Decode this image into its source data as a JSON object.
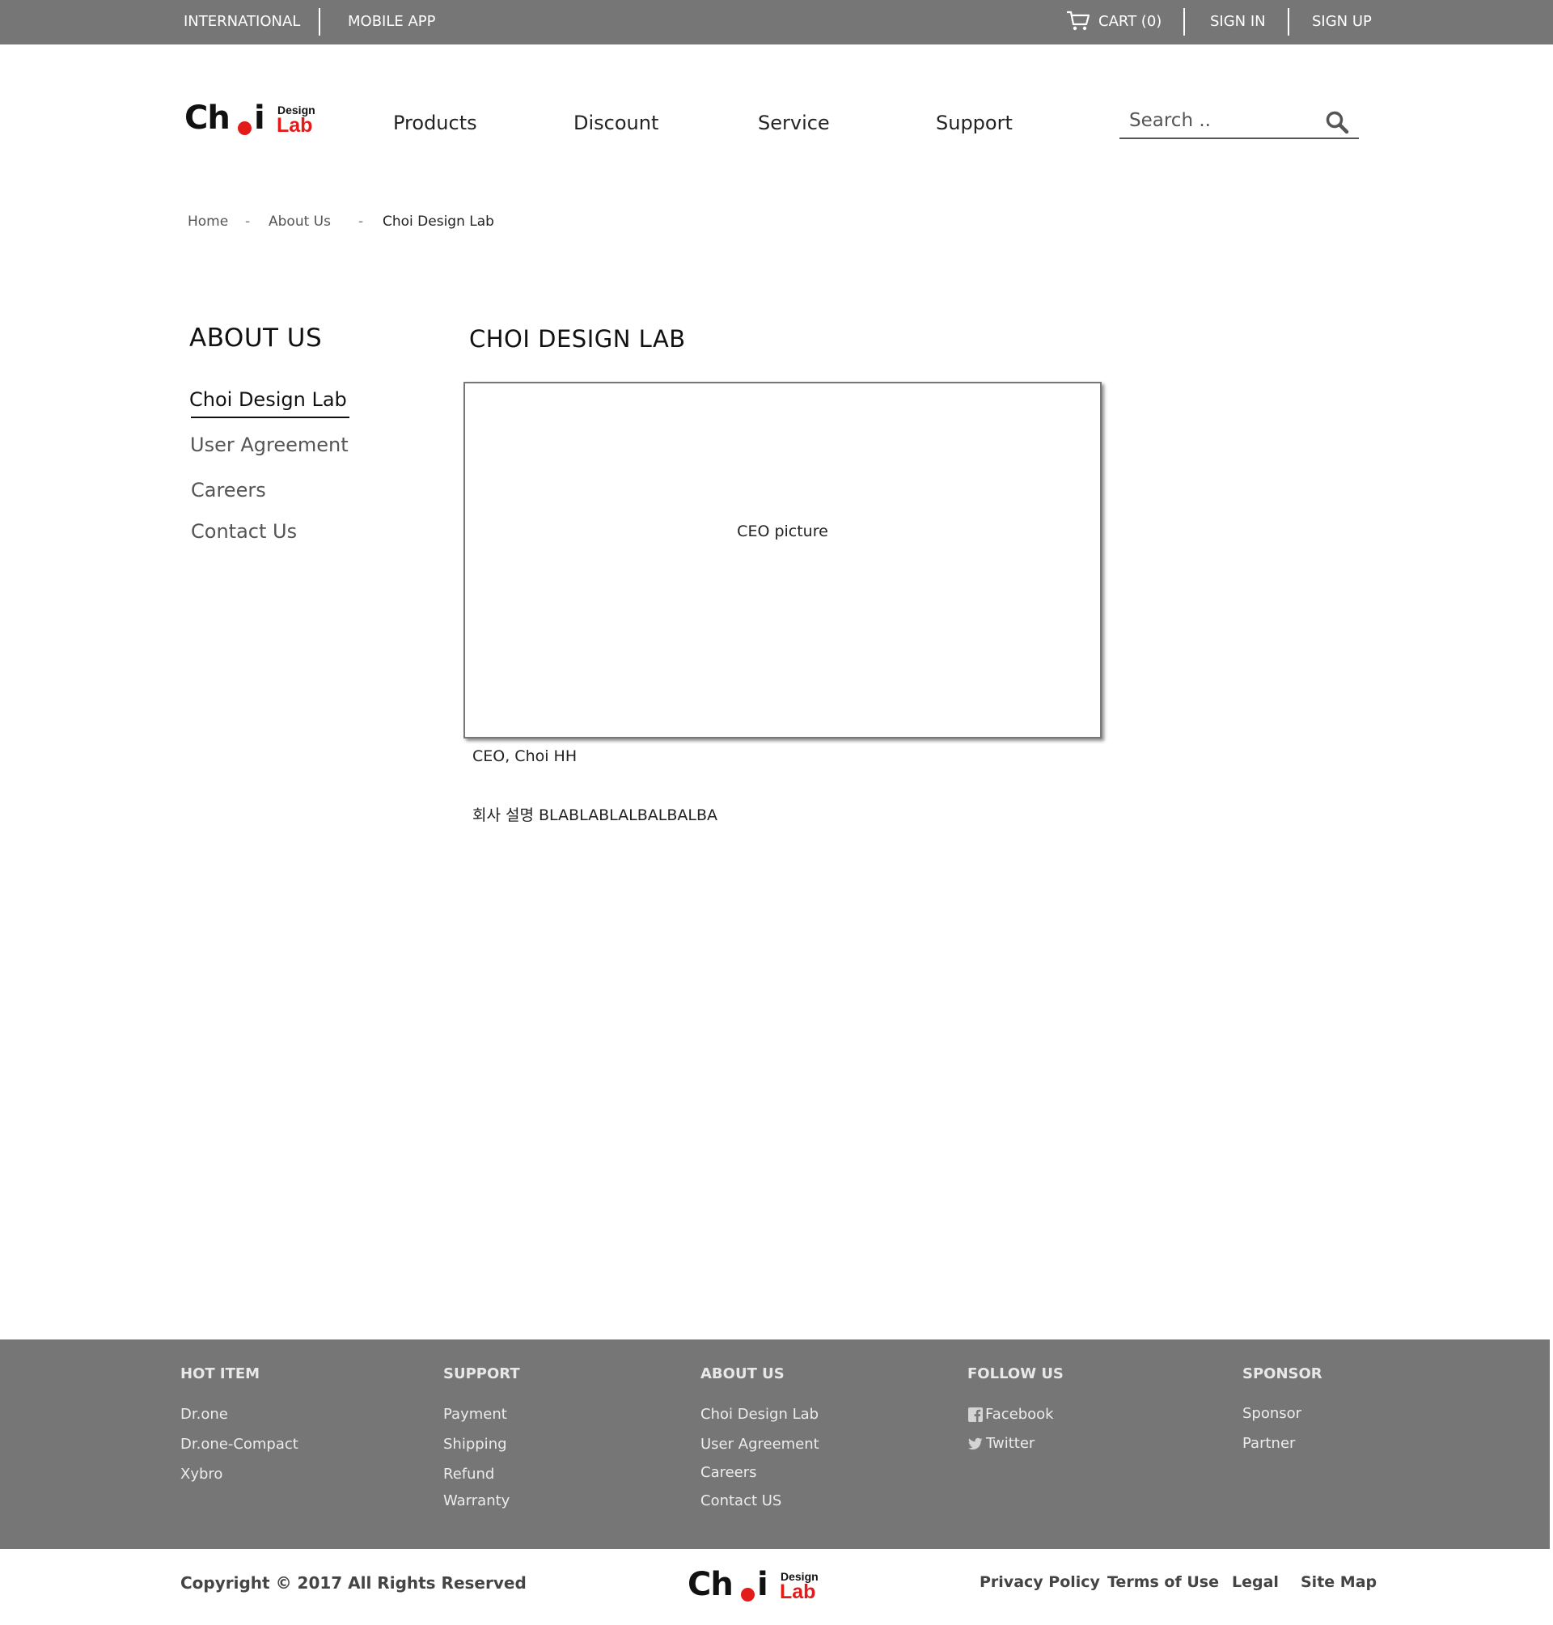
{
  "topbar": {
    "international": "INTERNATIONAL",
    "mobile_app": "MOBILE APP",
    "cart": "CART (0)",
    "sign_in": "SIGN IN",
    "sign_up": "SIGN UP",
    "background": "#767676"
  },
  "brand": {
    "name_main": "Ch",
    "name_tail": "i",
    "design": "Design",
    "lab": "Lab",
    "accent": "#e31b1b"
  },
  "nav": {
    "items": [
      "Products",
      "Discount",
      "Service",
      "Support"
    ]
  },
  "search": {
    "placeholder": "Search .."
  },
  "breadcrumb": {
    "items": [
      "Home",
      "About Us",
      "Choi Design Lab"
    ],
    "separator": "-"
  },
  "sidebar": {
    "title": "ABOUT US",
    "items": [
      "Choi Design Lab",
      "User Agreement",
      "Careers",
      "Contact Us"
    ],
    "active_index": 0
  },
  "main": {
    "title": "CHOI DESIGN LAB",
    "picture_label": "CEO picture",
    "caption": "CEO, Choi HH",
    "description": "회사 설명 BLABLABLALBALBALBA"
  },
  "footer": {
    "columns": [
      {
        "heading": "HOT ITEM",
        "items": [
          "Dr.one",
          "Dr.one-Compact",
          "Xybro"
        ]
      },
      {
        "heading": "SUPPORT",
        "items": [
          "Payment",
          "Shipping",
          "Refund",
          "Warranty"
        ]
      },
      {
        "heading": "ABOUT US",
        "items": [
          "Choi Design Lab",
          "User Agreement",
          "Careers",
          "Contact US"
        ]
      },
      {
        "heading": "FOLLOW US",
        "items": [
          "Facebook",
          "Twitter"
        ]
      },
      {
        "heading": "SPONSOR",
        "items": [
          "Sponsor",
          "Partner"
        ]
      }
    ],
    "copyright": "Copyright © 2017 All Rights Reserved",
    "links": [
      "Privacy Policy",
      "Terms of Use",
      "Legal",
      "Site Map"
    ]
  }
}
